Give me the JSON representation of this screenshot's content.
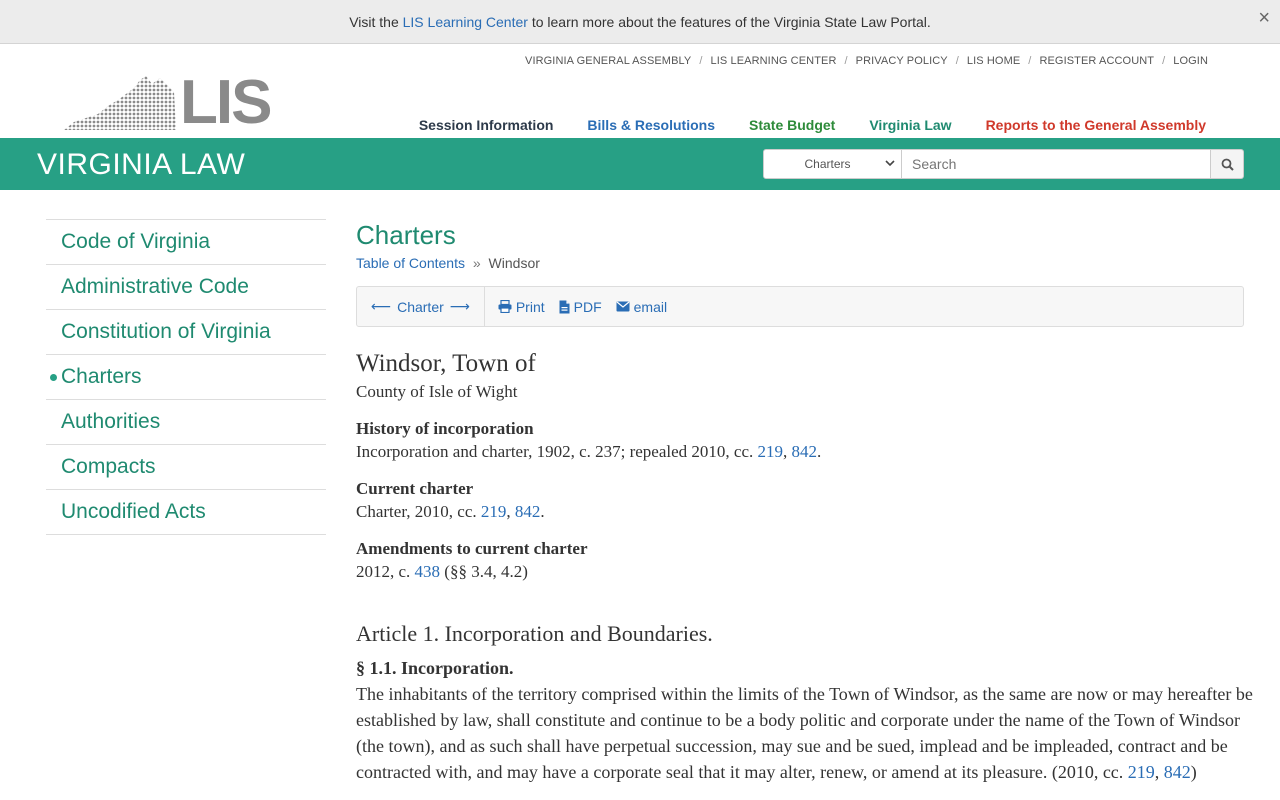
{
  "banner": {
    "prefix": "Visit the ",
    "link": "LIS Learning Center",
    "suffix": " to learn more about the features of the Virginia State Law Portal.",
    "close": "×"
  },
  "header": {
    "logo_text": "LIS",
    "top_links": [
      "VIRGINIA GENERAL ASSEMBLY",
      "LIS LEARNING CENTER",
      "PRIVACY POLICY",
      "LIS HOME",
      "REGISTER ACCOUNT",
      "LOGIN"
    ],
    "separator": "/",
    "main_nav": [
      {
        "label": "Session Information",
        "color": "#2d3a4a"
      },
      {
        "label": "Bills & Resolutions",
        "color": "#2a6db5"
      },
      {
        "label": "State Budget",
        "color": "#2e8b3a"
      },
      {
        "label": "Virginia Law",
        "color": "#1f8a70"
      },
      {
        "label": "Reports to the General Assembly",
        "color": "#d0392b"
      }
    ]
  },
  "tealbar": {
    "title": "VIRGINIA LAW",
    "search_scope": "Charters",
    "search_placeholder": "Search"
  },
  "sidebar": {
    "items": [
      {
        "label": "Code of Virginia",
        "active": false
      },
      {
        "label": "Administrative Code",
        "active": false
      },
      {
        "label": "Constitution of Virginia",
        "active": false
      },
      {
        "label": "Charters",
        "active": true
      },
      {
        "label": "Authorities",
        "active": false
      },
      {
        "label": "Compacts",
        "active": false
      },
      {
        "label": "Uncodified Acts",
        "active": false
      }
    ]
  },
  "main": {
    "title": "Charters",
    "breadcrumb": {
      "root": "Table of Contents",
      "sep": "»",
      "current": "Windsor"
    },
    "toolbar": {
      "prev": "⟵",
      "label": "Charter",
      "next": "⟶",
      "print": "Print",
      "pdf": "PDF",
      "email": "email"
    },
    "doc": {
      "title": "Windsor, Town of",
      "county": "County of Isle of Wight",
      "history_head": "History of incorporation",
      "history_text": "Incorporation and charter, 1902, c. 237; repealed 2010, cc. ",
      "history_link1": "219",
      "history_link2": "842",
      "current_head": "Current charter",
      "current_text": "Charter, 2010, cc. ",
      "current_link1": "219",
      "current_link2": "842",
      "amend_head": "Amendments to current charter",
      "amend_text": "2012, c. ",
      "amend_link": "438",
      "amend_suffix": " (§§ 3.4, 4.2)",
      "article": "Article 1. Incorporation and Boundaries.",
      "section_head": "§ 1.1. Incorporation.",
      "section_body": "The inhabitants of the territory comprised within the limits of the Town of Windsor, as the same are now or may hereafter be established by law, shall constitute and continue to be a body politic and corporate under the name of the Town of Windsor (the town), and as such shall have perpetual succession, may sue and be sued, implead and be impleaded, contract and be contracted with, and may have a corporate seal that it may alter, renew, or amend at its pleasure. (2010, cc. ",
      "section_link1": "219",
      "section_link2": "842",
      "section_end": ")"
    }
  }
}
